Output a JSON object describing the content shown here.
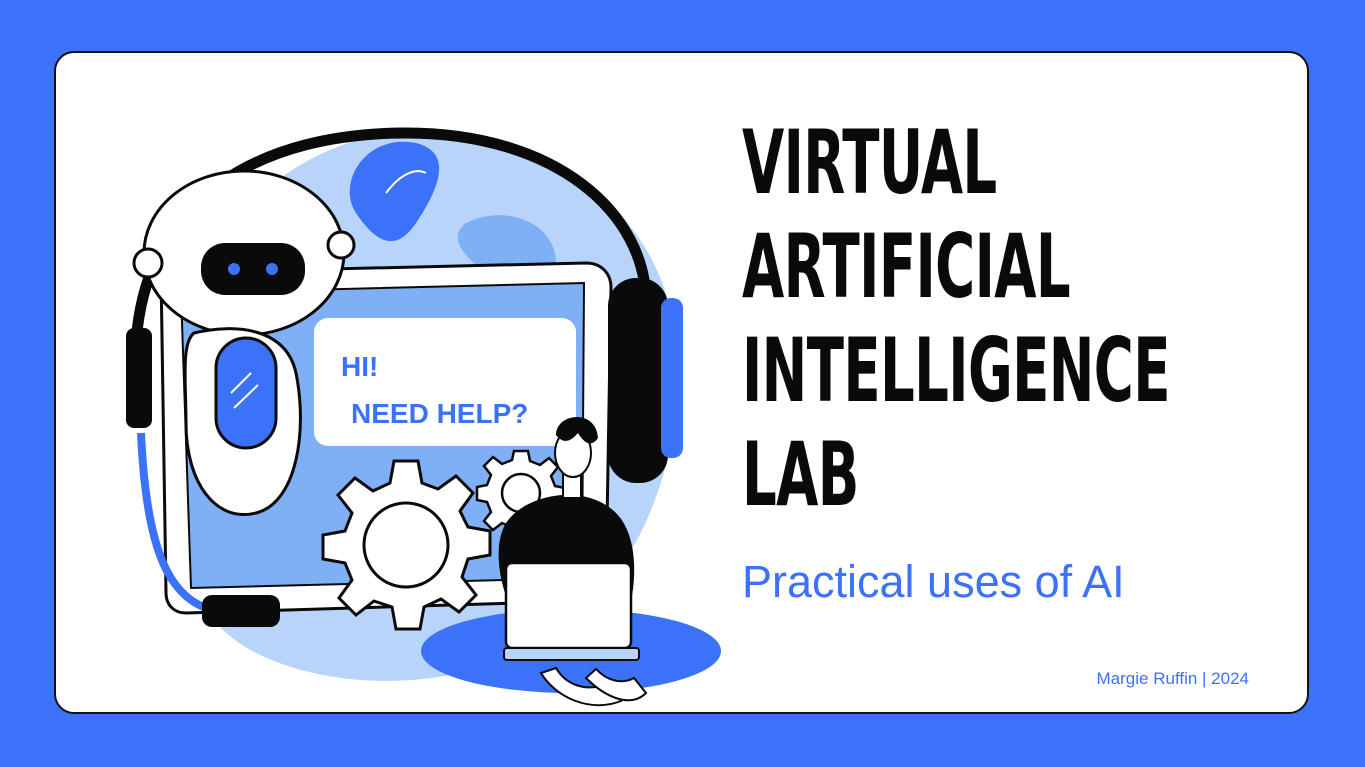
{
  "slide": {
    "title_lines": [
      "VIRTUAL",
      "ARTIFICIAL",
      "INTELLIGENCE",
      "LAB"
    ],
    "subtitle": "Practical uses of AI",
    "footer": "Margie Ruffin | 2024"
  },
  "illustration": {
    "bubble_line1": "HI!",
    "bubble_line2": "NEED HELP?",
    "icons": [
      "robot-icon",
      "headset-icon",
      "gear-icon",
      "laptop-icon",
      "person-icon"
    ]
  },
  "colors": {
    "accent": "#3b72f7",
    "light_blue": "#b9d4fb",
    "mid_blue": "#7fb0f5",
    "ink": "#0a0a0a",
    "background": "#ffffff"
  }
}
